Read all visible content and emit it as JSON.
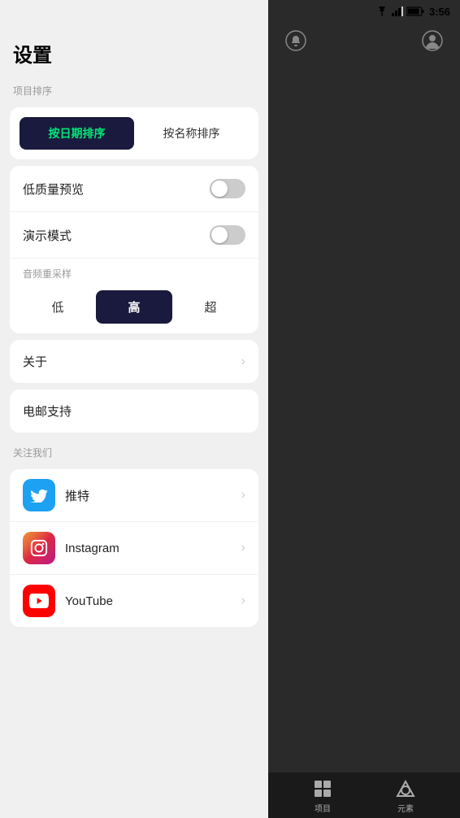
{
  "statusBar": {
    "time": "3:56"
  },
  "settings": {
    "title": "设置",
    "sortSection": {
      "label": "项目排序",
      "byDate": "按日期排序",
      "byName": "按名称排序",
      "activeIndex": 0
    },
    "toggles": [
      {
        "label": "低质量预览",
        "on": false
      },
      {
        "label": "演示模式",
        "on": false
      }
    ],
    "audioResample": {
      "label": "音频重采样",
      "options": [
        "低",
        "高",
        "超"
      ],
      "activeIndex": 1
    },
    "about": {
      "label": "关于",
      "chevron": "›"
    },
    "emailSupport": {
      "label": "电邮支持"
    },
    "followUs": {
      "label": "关注我们",
      "items": [
        {
          "name": "推特",
          "platform": "twitter",
          "chevron": "›"
        },
        {
          "name": "Instagram",
          "platform": "instagram",
          "chevron": "›"
        },
        {
          "name": "YouTube",
          "platform": "youtube",
          "chevron": "›"
        }
      ]
    }
  },
  "bottomNav": {
    "items": [
      {
        "label": "项目",
        "icon": "grid"
      },
      {
        "label": "元素",
        "icon": "elements"
      }
    ]
  }
}
